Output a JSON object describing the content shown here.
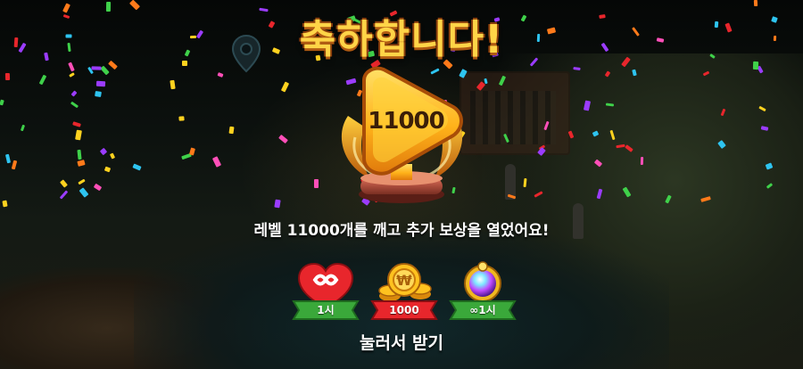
{
  "title": "축하합니다!",
  "trophy": {
    "level_number": "11000"
  },
  "message": "레벨 11000개를 깨고 추가 보상을 열었어요!",
  "rewards": [
    {
      "icon": "infinite-lives-heart-icon",
      "label": "1시"
    },
    {
      "icon": "gold-coins-icon",
      "label": "1000"
    },
    {
      "icon": "booster-orb-icon",
      "label": "∞1시"
    }
  ],
  "tap_prompt": "눌러서 받기",
  "colors": {
    "title_gold": "#ffd447",
    "ribbon_green": "#3aa83a",
    "trophy_gold": "#ffb21a"
  }
}
